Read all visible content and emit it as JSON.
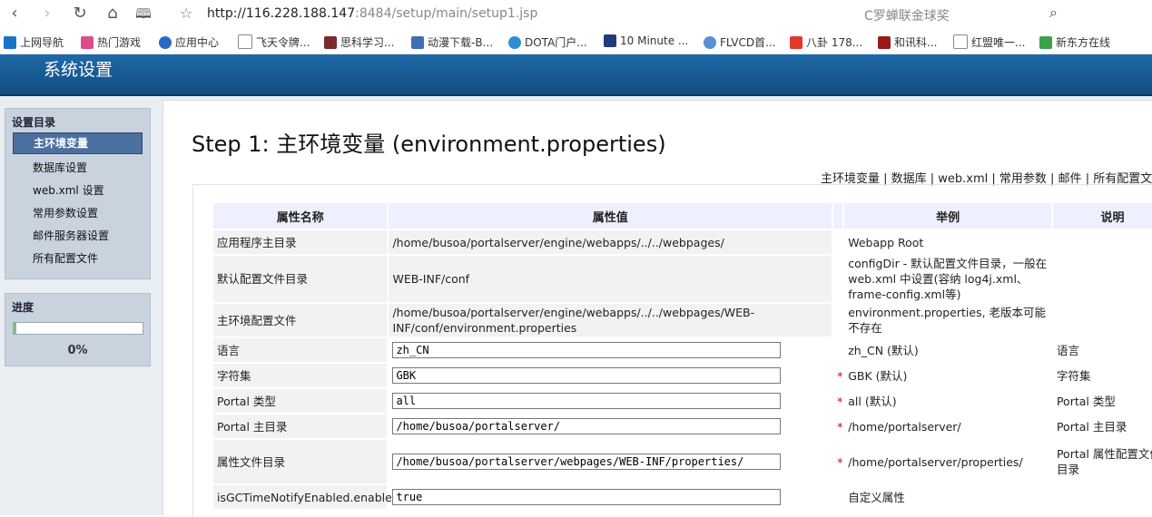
{
  "browser": {
    "url_host": "http://116.228.188.147",
    "url_rest": ":8484/setup/main/setup1.jsp",
    "search_text": "C罗蝉联金球奖",
    "bookmarks": [
      "上网导航",
      "热门游戏",
      "应用中心",
      "飞天令牌...",
      "思科学习...",
      "动漫下载-B...",
      "DOTA门户...",
      "10 Minute ...",
      "FLVCD首...",
      "八卦 178...",
      "和讯科...",
      "红盟唯一...",
      "新东方在线"
    ]
  },
  "header": {
    "title": "系统设置"
  },
  "sidebar": {
    "section_title": "设置目录",
    "items": [
      {
        "label": "主环境变量"
      },
      {
        "label": "数据库设置"
      },
      {
        "label": "web.xml 设置"
      },
      {
        "label": "常用参数设置"
      },
      {
        "label": "邮件服务器设置"
      },
      {
        "label": "所有配置文件"
      }
    ],
    "progress_title": "进度",
    "progress_value": 0.02,
    "progress_text": "0%"
  },
  "main": {
    "title": "Step 1: 主环境变量 (environment.properties)",
    "quicklinks": "主环境变量  | 数据库 | web.xml | 常用参数 | 邮件 | 所有配置文件",
    "columns": [
      "属性名称",
      "属性值",
      "",
      "举例",
      "说明"
    ],
    "rows": [
      {
        "name": "应用程序主目录",
        "value": "/home/busoa/portalserver/engine/webapps/../../webpages/",
        "required": "",
        "example": "Webapp Root",
        "desc": ""
      },
      {
        "name": "默认配置文件目录",
        "value": "WEB-INF/conf",
        "required": "",
        "example": "configDir - 默认配置文件目录，一般在 web.xml 中设置(容纳 log4j.xml、frame-config.xml等)",
        "desc": ""
      },
      {
        "name": "主环境配置文件",
        "value": "/home/busoa/portalserver/engine/webapps/../../webpages/WEB-INF/conf/environment.properties",
        "required": "",
        "example": "environment.properties, 老版本可能不存在",
        "desc": ""
      },
      {
        "name": "语言",
        "input": "zh_CN",
        "required": "",
        "example": "zh_CN (默认)",
        "desc": "语言"
      },
      {
        "name": "字符集",
        "input": "GBK",
        "required": "*",
        "example": "GBK (默认)",
        "desc": "字符集"
      },
      {
        "name": "Portal 类型",
        "input": "all",
        "required": "*",
        "example": "all (默认)",
        "desc": "Portal 类型"
      },
      {
        "name": "Portal 主目录",
        "input": "/home/busoa/portalserver/",
        "required": "*",
        "example": "/home/portalserver/",
        "desc": "Portal 主目录"
      },
      {
        "name": "属性文件目录",
        "input": "/home/busoa/portalserver/webpages/WEB-INF/properties/",
        "required": "*",
        "example": "/home/portalserver/properties/",
        "desc": "Portal 属性配置文件目录"
      },
      {
        "name": "isGCTimeNotifyEnabled.enabled",
        "input": "true",
        "required": "",
        "example": "自定义属性",
        "desc": ""
      }
    ]
  }
}
